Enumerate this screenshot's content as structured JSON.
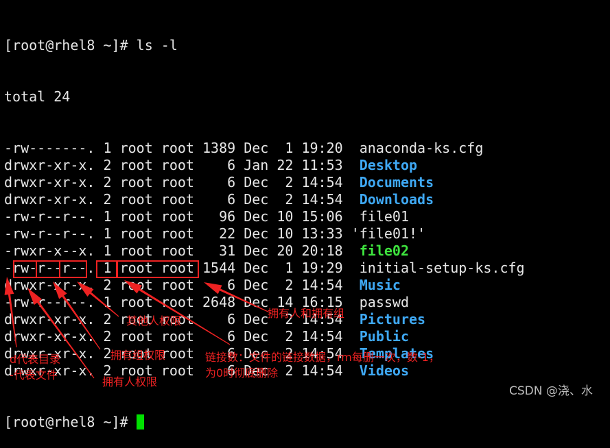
{
  "terminal": {
    "prompt": "[root@rhel8 ~]# ",
    "command": "ls -l",
    "total": "total 24",
    "rows": [
      {
        "meta": "-rw-------. 1 root root 1389 Dec  1 19:20  ",
        "name": "anaconda-ks.cfg",
        "type": "file"
      },
      {
        "meta": "drwxr-xr-x. 2 root root    6 Jan 22 11:53  ",
        "name": "Desktop",
        "type": "dir"
      },
      {
        "meta": "drwxr-xr-x. 2 root root    6 Dec  2 14:54  ",
        "name": "Documents",
        "type": "dir"
      },
      {
        "meta": "drwxr-xr-x. 2 root root    6 Dec  2 14:54  ",
        "name": "Downloads",
        "type": "dir"
      },
      {
        "meta": "-rw-r--r--. 1 root root   96 Dec 10 15:06  ",
        "name": "file01",
        "type": "file"
      },
      {
        "meta": "-rw-r--r--. 1 root root   22 Dec 10 13:33 ",
        "name": "'file01!'",
        "type": "file"
      },
      {
        "meta": "-rwxr-x--x. 1 root root   31 Dec 20 20:18  ",
        "name": "file02",
        "type": "exe"
      },
      {
        "meta": "-rw-r--r--. 1 root root 1544 Dec  1 19:29  ",
        "name": "initial-setup-ks.cfg",
        "type": "file"
      },
      {
        "meta": "drwxr-xr-x. 2 root root    6 Dec  2 14:54  ",
        "name": "Music",
        "type": "dir"
      },
      {
        "meta": "-rw-r--r--. 1 root root 2648 Dec 14 16:15  ",
        "name": "passwd",
        "type": "file"
      },
      {
        "meta": "drwxr-xr-x. 2 root root    6 Dec  2 14:54  ",
        "name": "Pictures",
        "type": "dir"
      },
      {
        "meta": "drwxr-xr-x. 2 root root    6 Dec  2 14:54  ",
        "name": "Public",
        "type": "dir"
      },
      {
        "meta": "drwxr-xr-x. 2 root root    6 Dec  2 14:54  ",
        "name": "Templates",
        "type": "dir"
      },
      {
        "meta": "drwxr-xr-x. 2 root root    6 Dec  2 14:54  ",
        "name": "Videos",
        "type": "dir"
      }
    ],
    "final_prompt": "[root@rhel8 ~]# ",
    "colors": {
      "dir": "#3fa9f5",
      "exe": "#3ee33e",
      "text": "#e6e6e6",
      "cursor": "#00e000"
    }
  },
  "annotations": {
    "type_line1": "d代表目录",
    "type_line2": "-代表文件",
    "owner_perm": "拥有人权限",
    "group_perm": "拥有组权限",
    "other_perm": "其他人权限",
    "owner_group": "拥有人和拥有组",
    "links_line1": "链接数：文件的链接数据，rm每删一次，数-1，",
    "links_line2": "为0时彻底删除",
    "color": "#ee2222"
  },
  "watermark": "CSDN @浇、水"
}
